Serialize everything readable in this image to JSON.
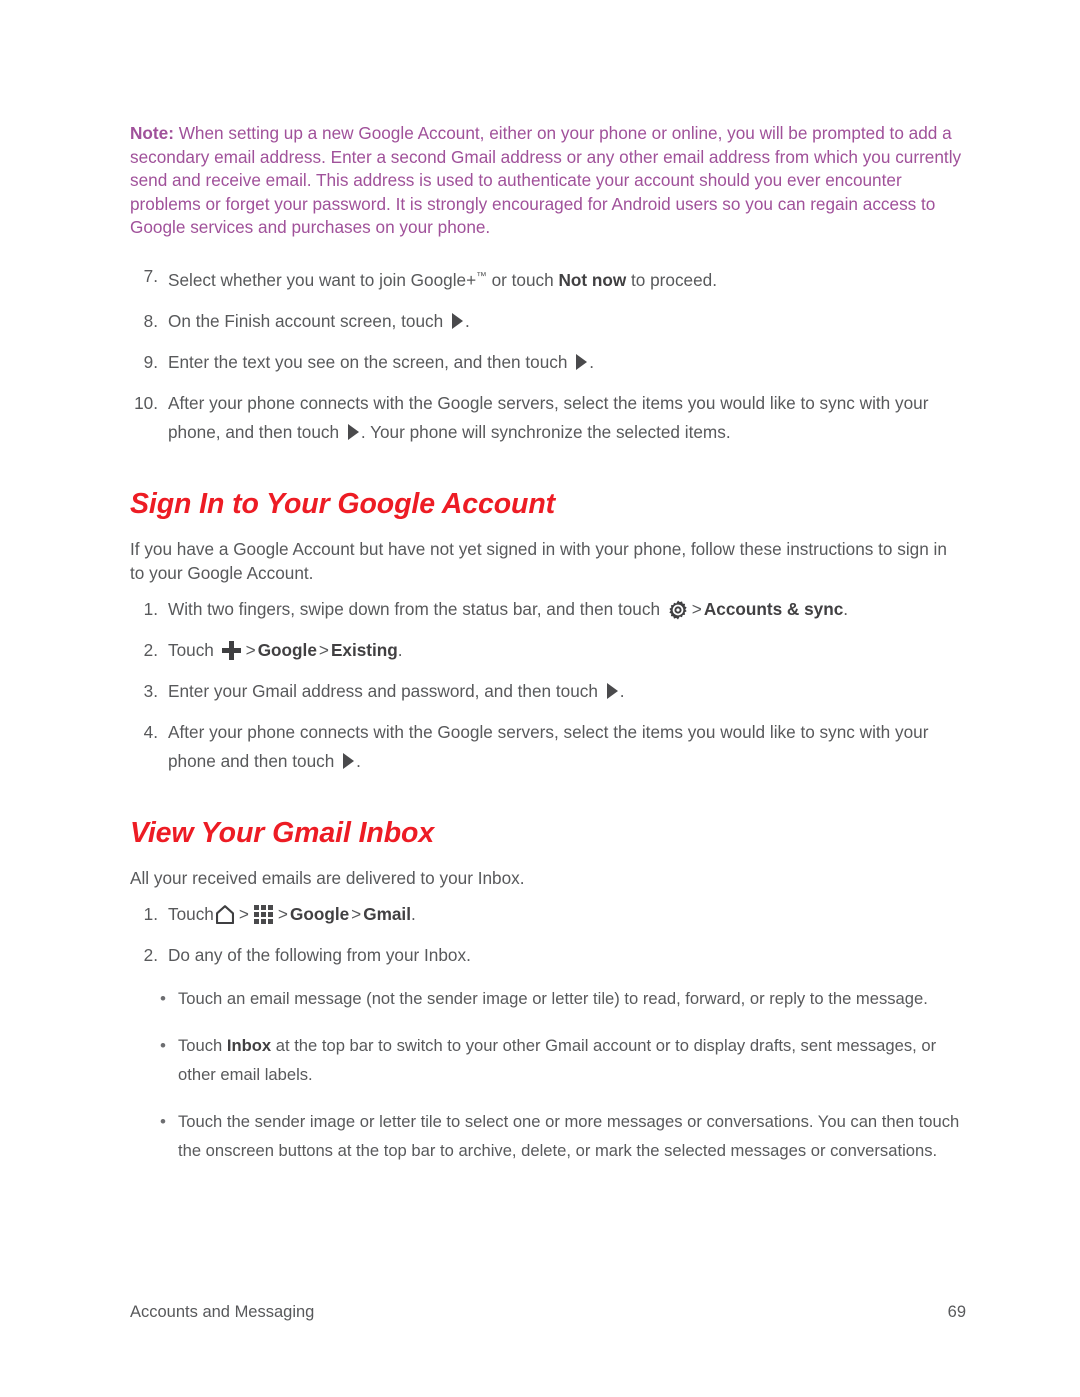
{
  "note": {
    "label": "Note:",
    "text": "When setting up a new Google Account, either on your phone or online, you will be prompted to add a secondary email address. Enter a second Gmail address or any other email address from which you currently send and receive email. This address is used to authenticate your account should you ever encounter problems or forget your password. It is strongly encouraged for Android users so you can regain access to Google services and purchases on your phone.",
    "color": "#a0519a"
  },
  "steps_continued": {
    "items": [
      {
        "num": "7.",
        "parts": [
          {
            "kind": "text",
            "value": "Select whether you want to join Google+"
          },
          {
            "kind": "tm",
            "value": "™"
          },
          {
            "kind": "text",
            "value": " or touch "
          },
          {
            "kind": "bold",
            "value": "Not now"
          },
          {
            "kind": "text",
            "value": " to proceed."
          }
        ]
      },
      {
        "num": "8.",
        "parts": [
          {
            "kind": "text",
            "value": "On the Finish account screen, touch "
          },
          {
            "kind": "icon",
            "value": "play-icon"
          },
          {
            "kind": "text",
            "value": "."
          }
        ]
      },
      {
        "num": "9.",
        "parts": [
          {
            "kind": "text",
            "value": "Enter the text you see on the screen, and then touch "
          },
          {
            "kind": "icon",
            "value": "play-icon"
          },
          {
            "kind": "text",
            "value": "."
          }
        ]
      },
      {
        "num": "10.",
        "parts": [
          {
            "kind": "text",
            "value": "After your phone connects with the Google servers, select the items you would like to sync with your phone, and then touch "
          },
          {
            "kind": "icon",
            "value": "play-icon"
          },
          {
            "kind": "text",
            "value": ". Your phone will synchronize the selected items."
          }
        ]
      }
    ]
  },
  "section_signin": {
    "heading": "Sign In to Your Google Account",
    "intro": "If you have a Google Account but have not yet signed in with your phone, follow these instructions to sign in to your Google Account.",
    "items": [
      {
        "num": "1.",
        "parts": [
          {
            "kind": "text",
            "value": "With two fingers, swipe down from the status bar, and then touch "
          },
          {
            "kind": "icon",
            "value": "gear-icon"
          },
          {
            "kind": "gt",
            "value": ">"
          },
          {
            "kind": "bold",
            "value": "Accounts & sync"
          },
          {
            "kind": "text",
            "value": "."
          }
        ]
      },
      {
        "num": "2.",
        "parts": [
          {
            "kind": "text",
            "value": "Touch "
          },
          {
            "kind": "icon",
            "value": "plus-icon"
          },
          {
            "kind": "gt",
            "value": ">"
          },
          {
            "kind": "bold",
            "value": "Google"
          },
          {
            "kind": "gt",
            "value": ">"
          },
          {
            "kind": "bold",
            "value": "Existing"
          },
          {
            "kind": "text",
            "value": "."
          }
        ]
      },
      {
        "num": "3.",
        "parts": [
          {
            "kind": "text",
            "value": "Enter your Gmail address and password, and then touch "
          },
          {
            "kind": "icon",
            "value": "play-icon"
          },
          {
            "kind": "text",
            "value": "."
          }
        ]
      },
      {
        "num": "4.",
        "parts": [
          {
            "kind": "text",
            "value": "After your phone connects with the Google servers, select the items you would like to sync with your phone and then touch "
          },
          {
            "kind": "icon",
            "value": "play-icon"
          },
          {
            "kind": "text",
            "value": "."
          }
        ]
      }
    ]
  },
  "section_gmail": {
    "heading": "View Your Gmail Inbox",
    "intro": "All your received emails are delivered to your Inbox.",
    "items": [
      {
        "num": "1.",
        "parts": [
          {
            "kind": "text",
            "value": "Touch"
          },
          {
            "kind": "icon",
            "value": "home-icon"
          },
          {
            "kind": "gt",
            "value": ">"
          },
          {
            "kind": "icon",
            "value": "apps-grid-icon"
          },
          {
            "kind": "gt",
            "value": ">"
          },
          {
            "kind": "bold",
            "value": "Google"
          },
          {
            "kind": "gt",
            "value": ">"
          },
          {
            "kind": "bold",
            "value": "Gmail"
          },
          {
            "kind": "text",
            "value": "."
          }
        ]
      },
      {
        "num": "2.",
        "parts": [
          {
            "kind": "text",
            "value": "Do any of the following from your Inbox."
          }
        ]
      }
    ],
    "bullets": [
      {
        "parts": [
          {
            "kind": "text",
            "value": "Touch an email message (not the sender image or letter tile) to read, forward, or reply to the message."
          }
        ]
      },
      {
        "parts": [
          {
            "kind": "text",
            "value": "Touch "
          },
          {
            "kind": "bold",
            "value": "Inbox"
          },
          {
            "kind": "text",
            "value": " at the top bar to switch to your other Gmail account or to display drafts, sent messages, or other email labels."
          }
        ]
      },
      {
        "parts": [
          {
            "kind": "text",
            "value": "Touch the sender image or letter tile to select one or more messages or conversations. You can then touch the onscreen buttons at the top bar to archive, delete, or mark the selected messages or conversations."
          }
        ]
      }
    ],
    "bullet_glyph": "•"
  },
  "footer": {
    "left": "Accounts and Messaging",
    "page_number": "69"
  },
  "colors": {
    "heading": "#ed1c24",
    "note": "#a0519a",
    "body": "#58595b"
  }
}
